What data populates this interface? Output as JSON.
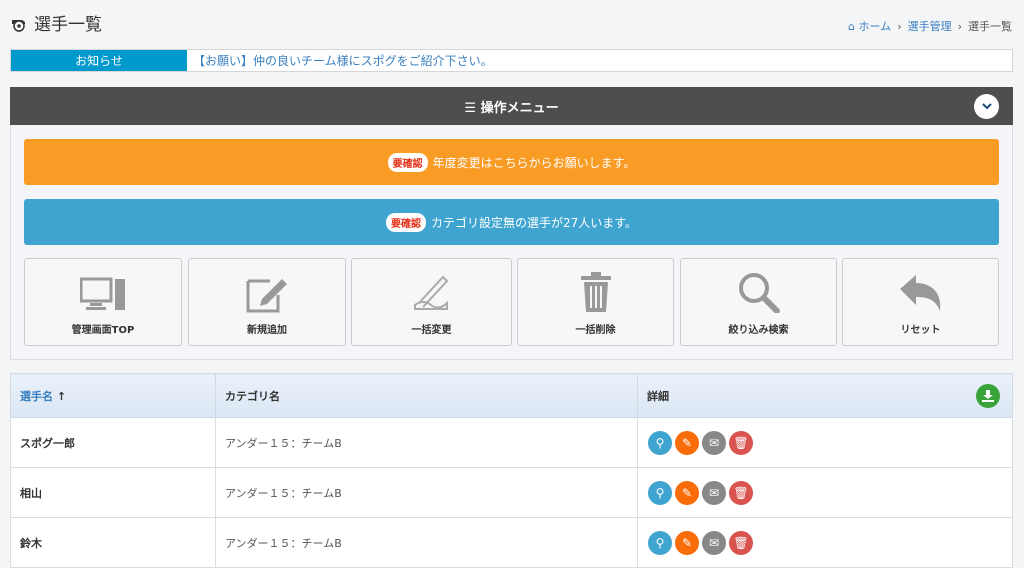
{
  "header": {
    "title": "選手一覧",
    "breadcrumb": [
      "ホーム",
      "選手管理",
      "選手一覧"
    ]
  },
  "notice": {
    "label": "お知らせ",
    "message": "【お願い】仲の良いチーム様にスポグをご紹介下さい。"
  },
  "menu": {
    "title": "☰ 操作メニュー",
    "alerts": [
      {
        "badge": "要確認",
        "text": "年度変更はこちらからお願いします。",
        "color": "#f99c26"
      },
      {
        "badge": "要確認",
        "text": "カテゴリ設定無の選手が27人います。",
        "color": "#3fa4cf"
      }
    ],
    "tiles": [
      {
        "label": "管理画面TOP",
        "icon": "monitor-icon"
      },
      {
        "label": "新規追加",
        "icon": "edit-icon"
      },
      {
        "label": "一括変更",
        "icon": "pen-hand-icon"
      },
      {
        "label": "一括削除",
        "icon": "trash-icon"
      },
      {
        "label": "絞り込み検索",
        "icon": "search-icon"
      },
      {
        "label": "リセット",
        "icon": "undo-icon"
      }
    ]
  },
  "table": {
    "columns": [
      "選手名",
      "カテゴリ名",
      "詳細"
    ],
    "rows": [
      {
        "name": "スポグ一郎",
        "category": "アンダー１５：チームB"
      },
      {
        "name": "相山",
        "category": "アンダー１５：チームB"
      },
      {
        "name": "鈴木",
        "category": "アンダー１５：チームB"
      }
    ]
  }
}
